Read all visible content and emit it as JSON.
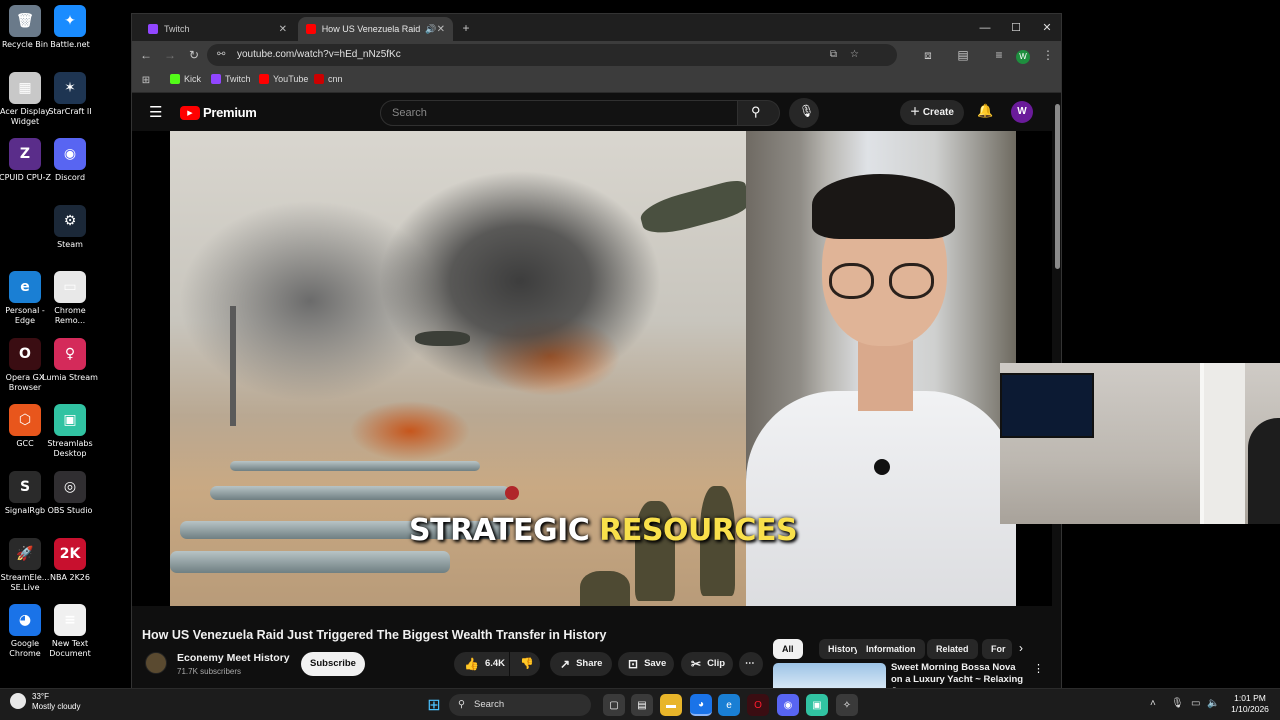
{
  "desktop": {
    "icons": [
      {
        "label": "Recycle Bin",
        "color": "#6a7a8a",
        "glyph": "🗑"
      },
      {
        "label": "Battle.net",
        "color": "#1a8cff",
        "glyph": "✦"
      },
      {
        "label": "Acer Display Widget",
        "color": "#c8c8c8",
        "glyph": "▦"
      },
      {
        "label": "StarCraft II",
        "color": "#1e3552",
        "glyph": "✶"
      },
      {
        "label": "CPUID CPU-Z",
        "color": "#5a2d8a",
        "glyph": "Z"
      },
      {
        "label": "Discord",
        "color": "#5865f2",
        "glyph": "◉"
      },
      {
        "label": "Steam",
        "color": "#1b2838",
        "glyph": "⚙"
      },
      {
        "label": "Personal - Edge",
        "color": "#1a7fd4",
        "glyph": "e"
      },
      {
        "label": "Chrome Remo...",
        "color": "#e8e8e8",
        "glyph": "▭"
      },
      {
        "label": "Opera GX Browser",
        "color": "#3a0d12",
        "glyph": "O"
      },
      {
        "label": "Lumia Stream",
        "color": "#d42a5a",
        "glyph": "♀"
      },
      {
        "label": "GCC",
        "color": "#e8561c",
        "glyph": "⬡"
      },
      {
        "label": "Streamlabs Desktop",
        "color": "#31c3a2",
        "glyph": "▣"
      },
      {
        "label": "SignalRgb",
        "color": "#2a2a2a",
        "glyph": "S"
      },
      {
        "label": "OBS Studio",
        "color": "#302e31",
        "glyph": "◎"
      },
      {
        "label": "StreamEle... SE.Live",
        "color": "#2a2a2a",
        "glyph": "🚀"
      },
      {
        "label": "NBA 2K26",
        "color": "#c8102e",
        "glyph": "2K"
      },
      {
        "label": "Google Chrome",
        "color": "#1a73e8",
        "glyph": "◕"
      },
      {
        "label": "New Text Document",
        "color": "#f0f0f0",
        "glyph": "≡"
      }
    ]
  },
  "browser": {
    "tabs": [
      {
        "label": "Twitch",
        "fav_color": "#9146ff"
      },
      {
        "label": "How US Venezuela Raid Ju",
        "fav_color": "#ff0000"
      }
    ],
    "new_tab": "+",
    "window_controls": {
      "minimize": "—",
      "maximize": "☐",
      "close": "✕"
    },
    "url": "youtube.com/watch?v=hEd_nNz5fKc",
    "bookmarks": [
      {
        "label": "Kick",
        "color": "#53fc18"
      },
      {
        "label": "Twitch",
        "color": "#9146ff"
      },
      {
        "label": "YouTube",
        "color": "#ff0000"
      },
      {
        "label": "cnn",
        "color": "#cc0000"
      }
    ],
    "profile_initial": "W"
  },
  "youtube": {
    "logo_text": "Premium",
    "search_placeholder": "Search",
    "create_label": "Create",
    "avatar_initial": "W",
    "caption": {
      "part1": "STRATEGIC ",
      "part2": "RESOURCES"
    },
    "video_title": "How US Venezuela Raid Just Triggered The Biggest Wealth Transfer in History",
    "channel_name": "Econemy Meet History",
    "subscribers": "71.7K subscribers",
    "subscribe_label": "Subscribe",
    "likes": "6.4K",
    "share_label": "Share",
    "save_label": "Save",
    "clip_label": "Clip",
    "chips": [
      "All",
      "History",
      "Information",
      "Related",
      "For"
    ],
    "recommendation_title": "Sweet Morning Bossa Nova on a Luxury Yacht ~ Relaxing Jaz"
  },
  "taskbar": {
    "weather_temp": "33°F",
    "weather_desc": "Mostly cloudy",
    "search_label": "Search",
    "time": "1:01 PM",
    "date": "1/10/2026"
  }
}
